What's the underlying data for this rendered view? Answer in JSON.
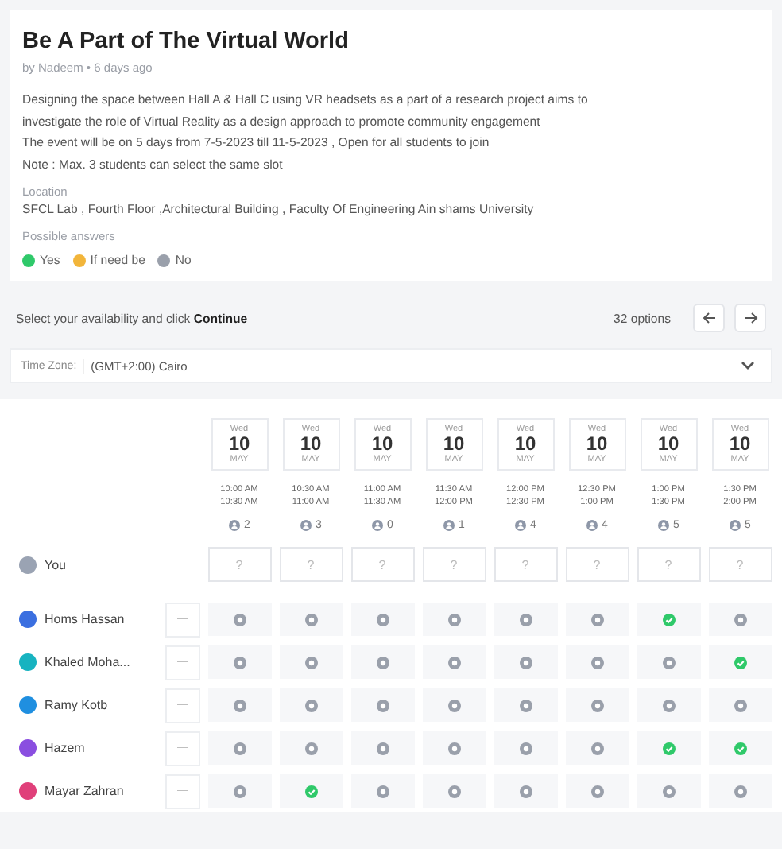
{
  "poll": {
    "title": "Be A Part of The Virtual World",
    "byline": "by Nadeem  • 6 days ago",
    "description": [
      "Designing the space between Hall A & Hall C using VR headsets as a part of a research project aims to",
      "investigate the role of Virtual Reality as a design approach to promote community engagement",
      "The event will be on 5 days from 7-5-2023 till 11-5-2023 , Open for all students to join",
      "Note : Max. 3 students can select the same slot"
    ],
    "location_label": "Location",
    "location": "SFCL Lab , Fourth Floor ,Architectural Building , Faculty Of Engineering Ain shams University",
    "answers_label": "Possible answers",
    "answers": [
      {
        "kind": "yes",
        "label": "Yes"
      },
      {
        "kind": "ifneedbe",
        "label": "If need be"
      },
      {
        "kind": "no",
        "label": "No"
      }
    ]
  },
  "toolbar": {
    "instruction": "Select your availability and click **Continue**",
    "options_count": "32 options"
  },
  "timezone": {
    "label": "Time Zone:",
    "value": "(GMT+2:00) Cairo"
  },
  "slots": [
    {
      "weekday": "Wed",
      "day": "10",
      "month": "MAY",
      "start": "10:00 AM",
      "end": "10:30 AM",
      "count": "2"
    },
    {
      "weekday": "Wed",
      "day": "10",
      "month": "MAY",
      "start": "10:30 AM",
      "end": "11:00 AM",
      "count": "3"
    },
    {
      "weekday": "Wed",
      "day": "10",
      "month": "MAY",
      "start": "11:00 AM",
      "end": "11:30 AM",
      "count": "0"
    },
    {
      "weekday": "Wed",
      "day": "10",
      "month": "MAY",
      "start": "11:30 AM",
      "end": "12:00 PM",
      "count": "1"
    },
    {
      "weekday": "Wed",
      "day": "10",
      "month": "MAY",
      "start": "12:00 PM",
      "end": "12:30 PM",
      "count": "4"
    },
    {
      "weekday": "Wed",
      "day": "10",
      "month": "MAY",
      "start": "12:30 PM",
      "end": "1:00 PM",
      "count": "4"
    },
    {
      "weekday": "Wed",
      "day": "10",
      "month": "MAY",
      "start": "1:00 PM",
      "end": "1:30 PM",
      "count": "5"
    },
    {
      "weekday": "Wed",
      "day": "10",
      "month": "MAY",
      "start": "1:30 PM",
      "end": "2:00 PM",
      "count": "5"
    }
  ],
  "you": {
    "name": "You",
    "cells": [
      "?",
      "?",
      "?",
      "?",
      "?",
      "?",
      "?",
      "?"
    ]
  },
  "participants": [
    {
      "name": "Homs Hassan",
      "color": "#3b6fe0",
      "dash": "—",
      "answers": [
        {
          "available": false
        },
        {
          "available": false
        },
        {
          "available": false
        },
        {
          "available": false
        },
        {
          "available": false
        },
        {
          "available": false
        },
        {
          "available": true
        },
        {
          "available": false
        }
      ]
    },
    {
      "name": "Khaled Moha...",
      "color": "#17b3c0",
      "dash": "—",
      "answers": [
        {
          "available": false
        },
        {
          "available": false
        },
        {
          "available": false
        },
        {
          "available": false
        },
        {
          "available": false
        },
        {
          "available": false
        },
        {
          "available": false
        },
        {
          "available": true
        }
      ]
    },
    {
      "name": "Ramy Kotb",
      "color": "#1f8fe0",
      "dash": "—",
      "answers": [
        {
          "available": false
        },
        {
          "available": false
        },
        {
          "available": false
        },
        {
          "available": false
        },
        {
          "available": false
        },
        {
          "available": false
        },
        {
          "available": false
        },
        {
          "available": false
        }
      ]
    },
    {
      "name": "Hazem",
      "color": "#8a4ee0",
      "dash": "—",
      "answers": [
        {
          "available": false
        },
        {
          "available": false
        },
        {
          "available": false
        },
        {
          "available": false
        },
        {
          "available": false
        },
        {
          "available": false
        },
        {
          "available": true
        },
        {
          "available": true
        }
      ]
    },
    {
      "name": "Mayar Zahran",
      "color": "#e0407a",
      "dash": "—",
      "answers": [
        {
          "available": false
        },
        {
          "available": true
        },
        {
          "available": false
        },
        {
          "available": false
        },
        {
          "available": false
        },
        {
          "available": false
        },
        {
          "available": false
        },
        {
          "available": false
        }
      ]
    }
  ]
}
